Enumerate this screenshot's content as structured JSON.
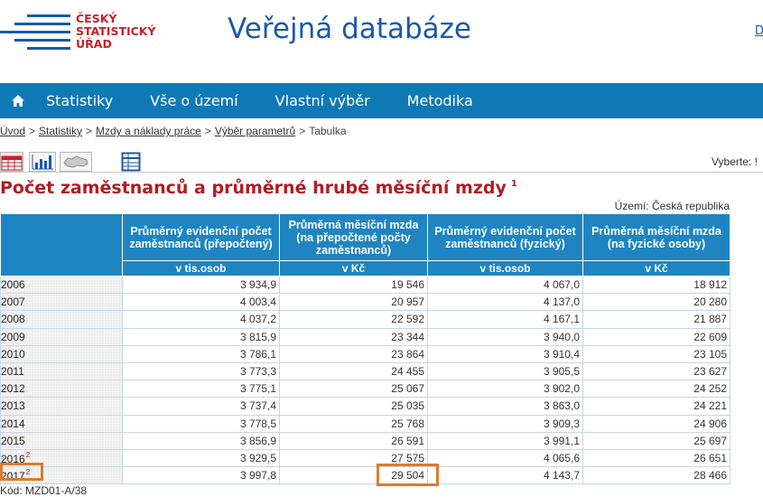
{
  "header": {
    "logo_lines": [
      "ČESKÝ",
      "STATISTICKÝ",
      "ÚŘAD"
    ],
    "site_title": "Veřejná databáze",
    "corner_link": "D"
  },
  "nav": {
    "home_icon": "home-icon",
    "items": [
      "Statistiky",
      "Vše o území",
      "Vlastní výběr",
      "Metodika"
    ]
  },
  "breadcrumb": {
    "links": [
      "Úvod",
      "Statistiky",
      "Mzdy a náklady práce",
      "Výběr parametrů"
    ],
    "current": "Tabulka",
    "separator": ">"
  },
  "toolbar": {
    "buttons": [
      "table-view-icon",
      "chart-view-icon",
      "map-view-icon",
      "export-table-icon"
    ],
    "select_label": "Vyberte: !"
  },
  "page": {
    "title": "Počet zaměstnanců a průměrné hrubé měsíční mzdy",
    "title_note": "1",
    "territory": "Území: Česká republika",
    "code": "Kód: MZD01-A/38"
  },
  "table": {
    "headers": [
      "Průměrný evidenční počet zaměstnanců (přepočtený)",
      "Průměrná měsíční mzda (na přepočtené počty zaměstnanců)",
      "Průměrný evidenční počet zaměstnanců (fyzický)",
      "Průměrná měsíční mzda (na fyzické osoby)"
    ],
    "units": [
      "v tis.osob",
      "v Kč",
      "v tis.osob",
      "v Kč"
    ],
    "rows": [
      {
        "year": "2006",
        "note": "",
        "values": [
          "3 934,9",
          "19 546",
          "4 067,0",
          "18 912"
        ]
      },
      {
        "year": "2007",
        "note": "",
        "values": [
          "4 003,4",
          "20 957",
          "4 137,0",
          "20 280"
        ]
      },
      {
        "year": "2008",
        "note": "",
        "values": [
          "4 037,2",
          "22 592",
          "4 167,1",
          "21 887"
        ]
      },
      {
        "year": "2009",
        "note": "",
        "values": [
          "3 815,9",
          "23 344",
          "3 940,0",
          "22 609"
        ]
      },
      {
        "year": "2010",
        "note": "",
        "values": [
          "3 786,1",
          "23 864",
          "3 910,4",
          "23 105"
        ]
      },
      {
        "year": "2011",
        "note": "",
        "values": [
          "3 773,3",
          "24 455",
          "3 905,5",
          "23 627"
        ]
      },
      {
        "year": "2012",
        "note": "",
        "values": [
          "3 775,1",
          "25 067",
          "3 902,0",
          "24 252"
        ]
      },
      {
        "year": "2013",
        "note": "",
        "values": [
          "3 737,4",
          "25 035",
          "3 863,0",
          "24 221"
        ]
      },
      {
        "year": "2014",
        "note": "",
        "values": [
          "3 778,5",
          "25 768",
          "3 909,3",
          "24 906"
        ]
      },
      {
        "year": "2015",
        "note": "",
        "values": [
          "3 856,9",
          "26 591",
          "3 991,1",
          "25 697"
        ]
      },
      {
        "year": "2016",
        "note": "2",
        "values": [
          "3 929,5",
          "27 575",
          "4 065,6",
          "26 651"
        ]
      },
      {
        "year": "2017",
        "note": "2",
        "values": [
          "3 997,8",
          "29 504",
          "4 143,7",
          "28 466"
        ]
      }
    ]
  },
  "colors": {
    "brand_blue": "#1a5aa8",
    "nav_blue": "#0f79b5",
    "header_blue": "#1f85c2",
    "title_red": "#b01c23",
    "highlight_orange": "#e07a2c"
  }
}
